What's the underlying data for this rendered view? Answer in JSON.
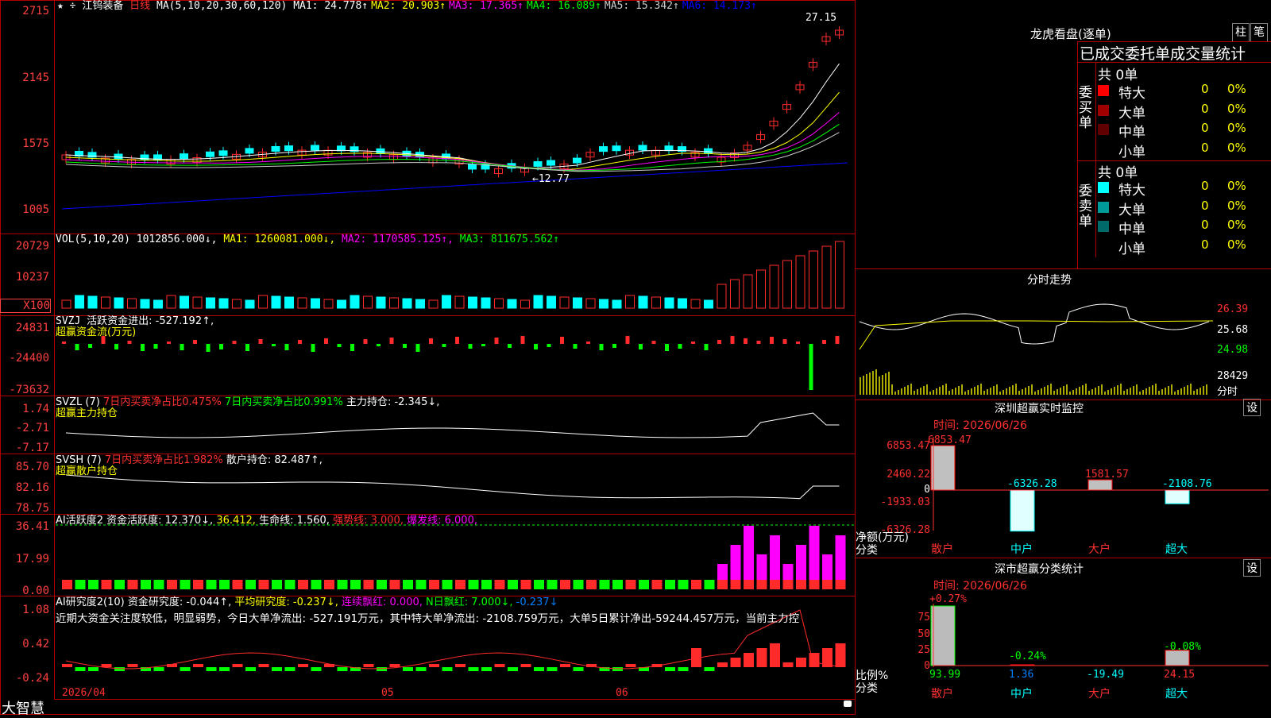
{
  "app": {
    "brand": "大智慧"
  },
  "colors": {
    "up": "#ff2a2a",
    "down": "#00ffff",
    "grid": "#b00000",
    "ma1": "#ffffff",
    "ma2": "#ffff00",
    "ma3": "#ff00ff",
    "ma4": "#00ff00",
    "ma5": "#cccccc",
    "ma6": "#0000ff"
  },
  "main": {
    "stock_name": "江钨装备",
    "period": "日线",
    "ma_params": "MA(5,10,20,30,60,120)",
    "ma_legend": [
      {
        "label": "MA1: 24.778↑",
        "color": "#ffffff"
      },
      {
        "label": "MA2: 20.903↑",
        "color": "#ffff00"
      },
      {
        "label": "MA3: 17.365↑",
        "color": "#ff00ff"
      },
      {
        "label": "MA4: 16.089↑",
        "color": "#00ff00"
      },
      {
        "label": "MA5: 15.342↑",
        "color": "#cccccc"
      },
      {
        "label": "MA6: 14.173↑",
        "color": "#0000ff"
      }
    ],
    "y_ticks": [
      "2715",
      "2145",
      "1575",
      "1005"
    ],
    "high_mark": "27.15",
    "low_mark": "12.77",
    "x_dates": [
      "2026/04",
      "05",
      "06"
    ]
  },
  "vol": {
    "title": "VOL(5,10,20)",
    "value": "1012856.000↓,",
    "ma1": "MA1: 1260081.000↓,",
    "ma2": "MA2: 1170585.125↑,",
    "ma3": "MA3: 811675.562↑",
    "y_ticks": [
      "20729",
      "10237"
    ],
    "multiplier": "X100"
  },
  "svzj": {
    "title": "SVZJ",
    "line1": "活跃资金进出: -527.192↑,",
    "line2": "超赢资金流(万元)",
    "y_ticks": [
      "24831",
      "-24400",
      "-73632"
    ]
  },
  "svzl": {
    "title": "SVZL (7)",
    "a": "7日内买卖净占比0.475%",
    "b": "7日内买卖净占比0.991%",
    "c": "主力持仓: -2.345↓,",
    "line2": "超赢主力持仓",
    "y_ticks": [
      "1.74",
      "-2.71",
      "-7.17"
    ]
  },
  "svsh": {
    "title": "SVSH (7)",
    "a": "7日内买卖净占比1.982%",
    "b": "散户持仓: 82.487↑,",
    "line2": "超赢散户持仓",
    "y_ticks": [
      "85.70",
      "82.16",
      "78.75"
    ]
  },
  "ai1": {
    "title": "AI活跃度2",
    "a": "资金活跃度: 12.370↓,",
    "b": "36.412,",
    "c": "生命线: 1.560,",
    "d": "强势线: 3.000,",
    "e": "爆发线: 6.000,",
    "y_ticks": [
      "36.41",
      "17.99",
      "0.00"
    ]
  },
  "ai2": {
    "title": "AI研究度2(10)",
    "a": "资金研究度: -0.044↑,",
    "b": "平均研究度: -0.237↓,",
    "c": "连续飘红: 0.000,",
    "d": "N日飘红: 7.000↓,",
    "e": "-0.237↓",
    "comment": "近期大资金关注度较低，明显弱势，今日大单净流出: -527.191万元，其中特大单净流出: -2108.759万元，大单5日累计净出-59244.457万元，当前主力控",
    "y_ticks": [
      "1.08",
      "0.42",
      "-0.24"
    ]
  },
  "lhb": {
    "title": "龙虎看盘(逐单)",
    "btn_zhu": "柱",
    "btn_bi": "笔",
    "header": "已成交委托单成交量统计",
    "buy_label": "委买单",
    "sell_label": "委卖单",
    "buy_total": "共 0单",
    "sell_total": "共 0单",
    "buy_rows": [
      {
        "name": "特大",
        "count": "0",
        "pct": "0%",
        "color": "#ff0000"
      },
      {
        "name": "大单",
        "count": "0",
        "pct": "0%",
        "color": "#a00000"
      },
      {
        "name": "中单",
        "count": "0",
        "pct": "0%",
        "color": "#600000"
      },
      {
        "name": "小单",
        "count": "0",
        "pct": "0%",
        "color": "#000000"
      }
    ],
    "sell_rows": [
      {
        "name": "特大",
        "count": "0",
        "pct": "0%",
        "color": "#00ffff"
      },
      {
        "name": "大单",
        "count": "0",
        "pct": "0%",
        "color": "#009a9a"
      },
      {
        "name": "中单",
        "count": "0",
        "pct": "0%",
        "color": "#006a6a"
      },
      {
        "name": "小单",
        "count": "0",
        "pct": "0%",
        "color": "#000000"
      }
    ]
  },
  "intraday": {
    "title": "分时走势",
    "y_ticks": [
      "26.39",
      "25.68",
      "24.98"
    ],
    "vol_tick": "28429",
    "unit": "分时"
  },
  "sz_monitor": {
    "title": "深圳超赢实时监控",
    "btn": "设",
    "time": "时间: 2026/06/26",
    "y_ticks": [
      "6853.47",
      "2460.22",
      "0",
      "-1933.03",
      "-6326.28"
    ],
    "ylabel": "净额(万元)",
    "xlabel": "分类",
    "categories": [
      "散户",
      "中户",
      "大户",
      "超大"
    ],
    "values": [
      "6853.47",
      "-6326.28",
      "1581.57",
      "-2108.76"
    ]
  },
  "sz_stats": {
    "title": "深市超赢分类统计",
    "btn": "设",
    "time": "时间: 2026/06/26",
    "y_ticks": [
      "75",
      "50",
      "25",
      "0"
    ],
    "ylabel": "比例%",
    "xlabel": "分类",
    "categories": [
      "散户",
      "中户",
      "大户",
      "超大"
    ],
    "values": [
      "93.99",
      "1.36",
      "-19.49",
      "24.15"
    ],
    "changes": [
      "+0.27%",
      "-0.24%",
      "",
      "-0.08%"
    ]
  },
  "chart_data": [
    {
      "type": "bar",
      "title": "深圳超赢实时监控",
      "ylabel": "净额(万元)",
      "xlabel": "分类",
      "categories": [
        "散户",
        "中户",
        "大户",
        "超大"
      ],
      "values": [
        6853.47,
        -6326.28,
        1581.57,
        -2108.76
      ],
      "ylim": [
        -6326.28,
        6853.47
      ]
    },
    {
      "type": "bar",
      "title": "深市超赢分类统计",
      "ylabel": "比例%",
      "xlabel": "分类",
      "categories": [
        "散户",
        "中户",
        "大户",
        "超大"
      ],
      "values": [
        93.99,
        1.36,
        -19.49,
        24.15
      ],
      "ylim": [
        0,
        93.99
      ]
    }
  ]
}
